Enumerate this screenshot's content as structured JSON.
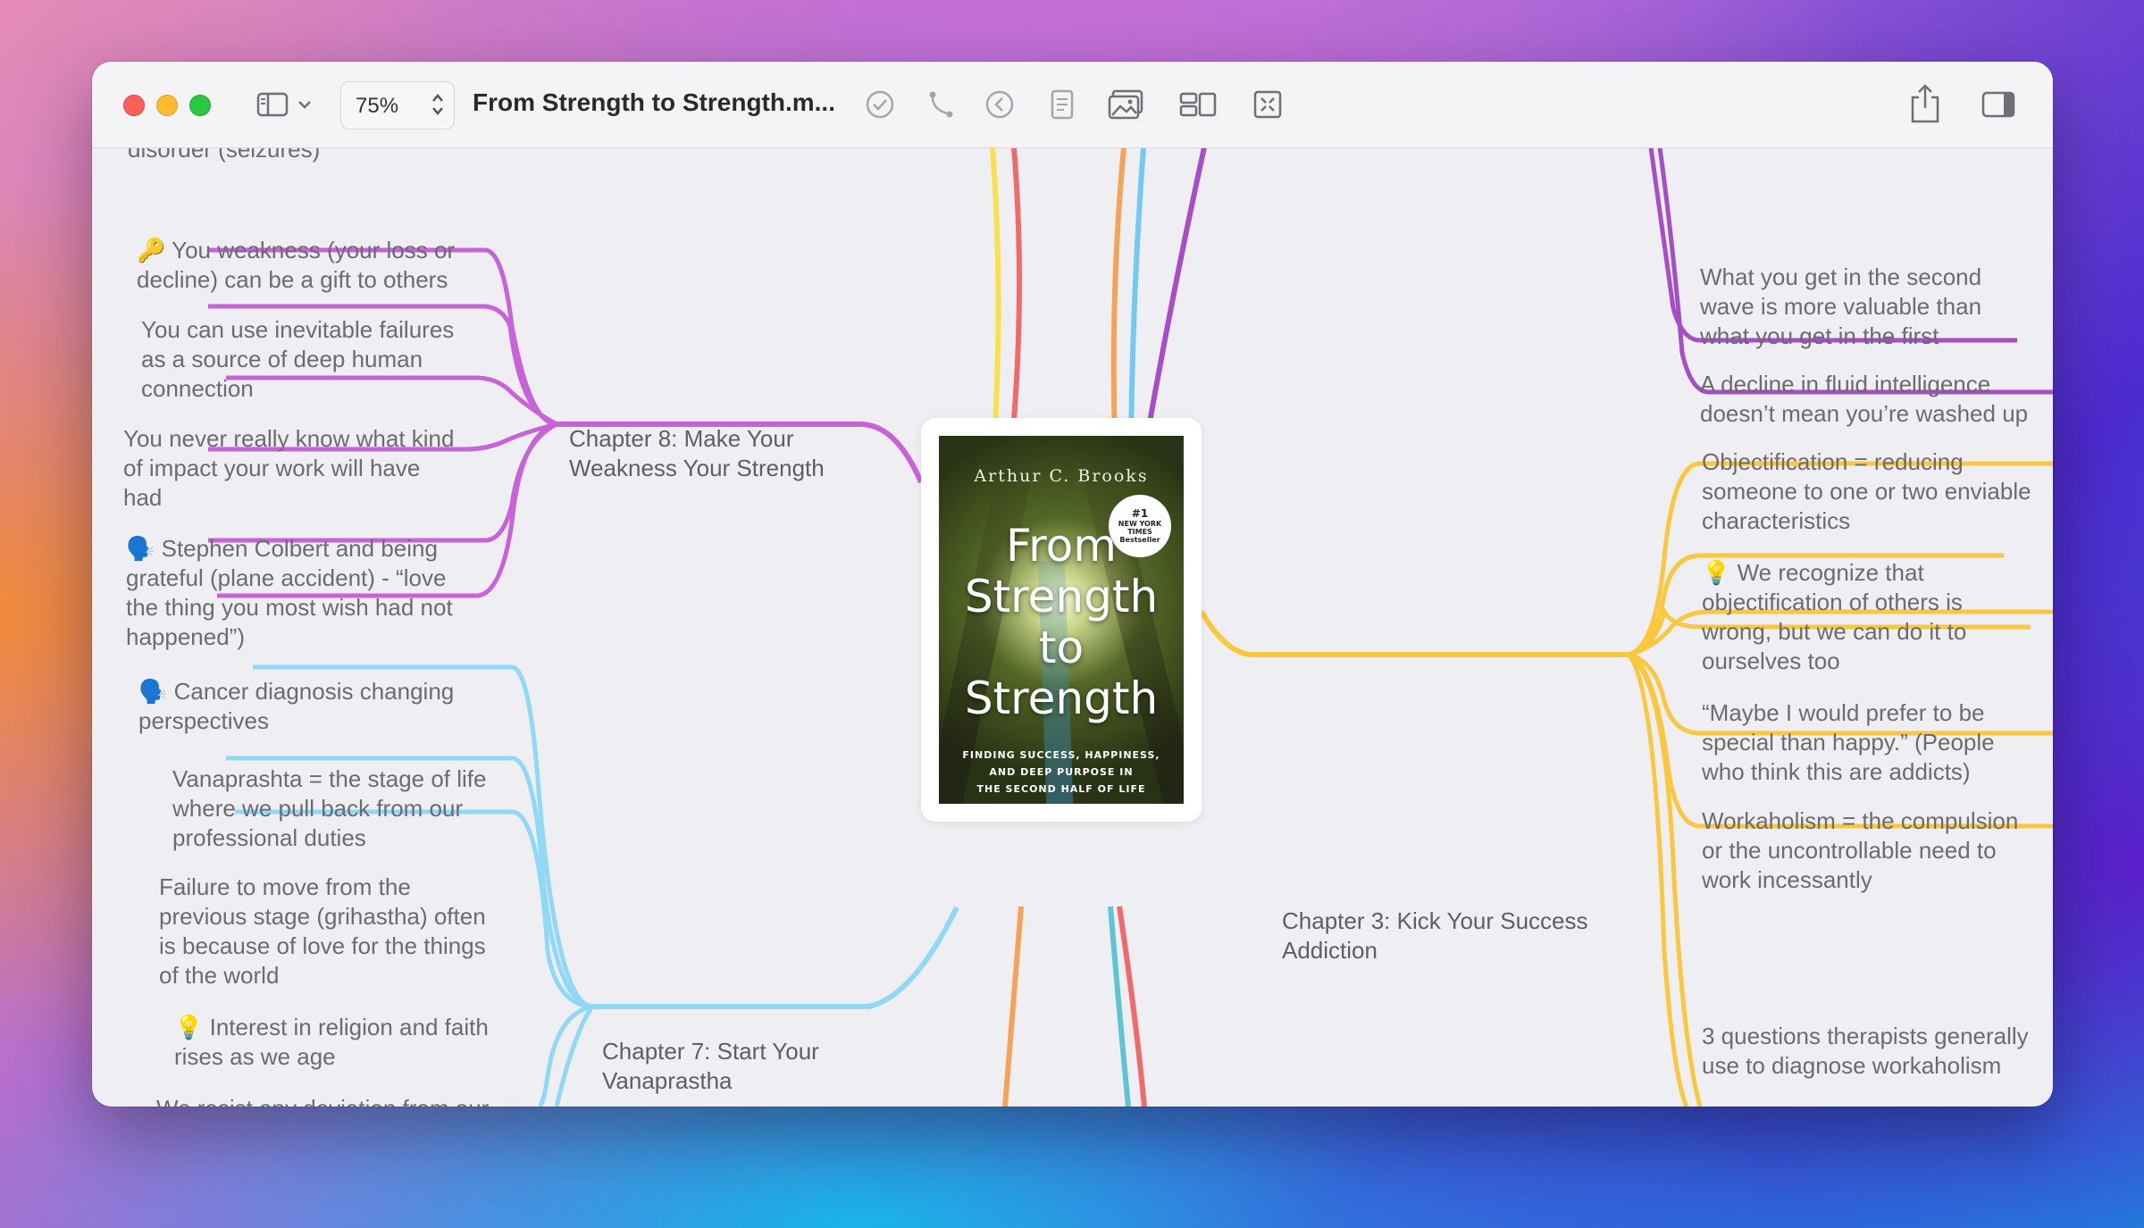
{
  "toolbar": {
    "zoom": "75%",
    "title": "From Strength to Strength.m...",
    "icons": [
      "sidebar-icon",
      "chevron-down-icon",
      "checkmark-icon",
      "relationship-icon",
      "back-icon",
      "note-icon",
      "image-icon",
      "layout-icon",
      "focus-icon",
      "share-icon",
      "inspector-icon"
    ]
  },
  "colors": {
    "purple": "#c862d9",
    "light_blue": "#8fd9f6",
    "yellow": "#f9c83f",
    "dark_purple": "#a54ec6",
    "red": "#ef6a6a",
    "orange": "#f5a25b",
    "teal": "#5cc4d3"
  },
  "book": {
    "author": "Arthur C. Brooks",
    "title_lines": [
      "From",
      "Strength",
      "to",
      "Strength"
    ],
    "subtitle_lines": [
      "FINDING SUCCESS, HAPPINESS,",
      "AND DEEP PURPOSE IN",
      "THE SECOND HALF OF LIFE"
    ],
    "badge_top": "#1",
    "badge_lines": [
      "NEW YORK",
      "TIMES",
      "Bestseller"
    ]
  },
  "ch8": {
    "title": "Chapter 8: Make Your\nWeakness Your Strength",
    "items": [
      "disorder (seizures)",
      "🔑 You weakness (your loss or\ndecline) can be a gift to others",
      "You can use inevitable failures\nas a source of deep human\nconnection",
      "You never really know what kind\nof impact your work will have\nhad",
      "🗣️ Stephen Colbert and being\ngrateful (plane accident) - “love\nthe thing you most wish had not\nhappened”)",
      "🗣️ Cancer diagnosis changing\nperspectives"
    ]
  },
  "ch7": {
    "title": "Chapter 7: Start Your\nVanaprastha",
    "items": [
      "Vanaprashta = the stage of life\nwhere we pull back from our\nprofessional duties",
      "Failure to move from the\nprevious stage (grihastha) often\nis because of love for the things\nof the world",
      "💡 Interest in religion and faith\nrises as we age",
      "We resist any deviation from our\nself-concept because it\nprovokes feelings of uncertainty"
    ]
  },
  "top_right": {
    "items": [
      "What you get in the second\nwave is more valuable than\nwhat you get in the first",
      "A decline in fluid intelligence\ndoesn’t mean you’re washed up"
    ]
  },
  "ch3": {
    "title": "Chapter 3: Kick Your Success\nAddiction",
    "items": [
      "Objectification = reducing\nsomeone to one or two enviable\ncharacteristics",
      "💡 We recognize that\nobjectification of others is\nwrong, but we can do it to\nourselves too",
      "“Maybe I would prefer to be\nspecial than happy.” (People\nwho think this are addicts)",
      "Workaholism = the compulsion\nor the uncontrollable need to\nwork incessantly",
      "3 questions therapists generally\nuse to diagnose workaholism"
    ]
  }
}
